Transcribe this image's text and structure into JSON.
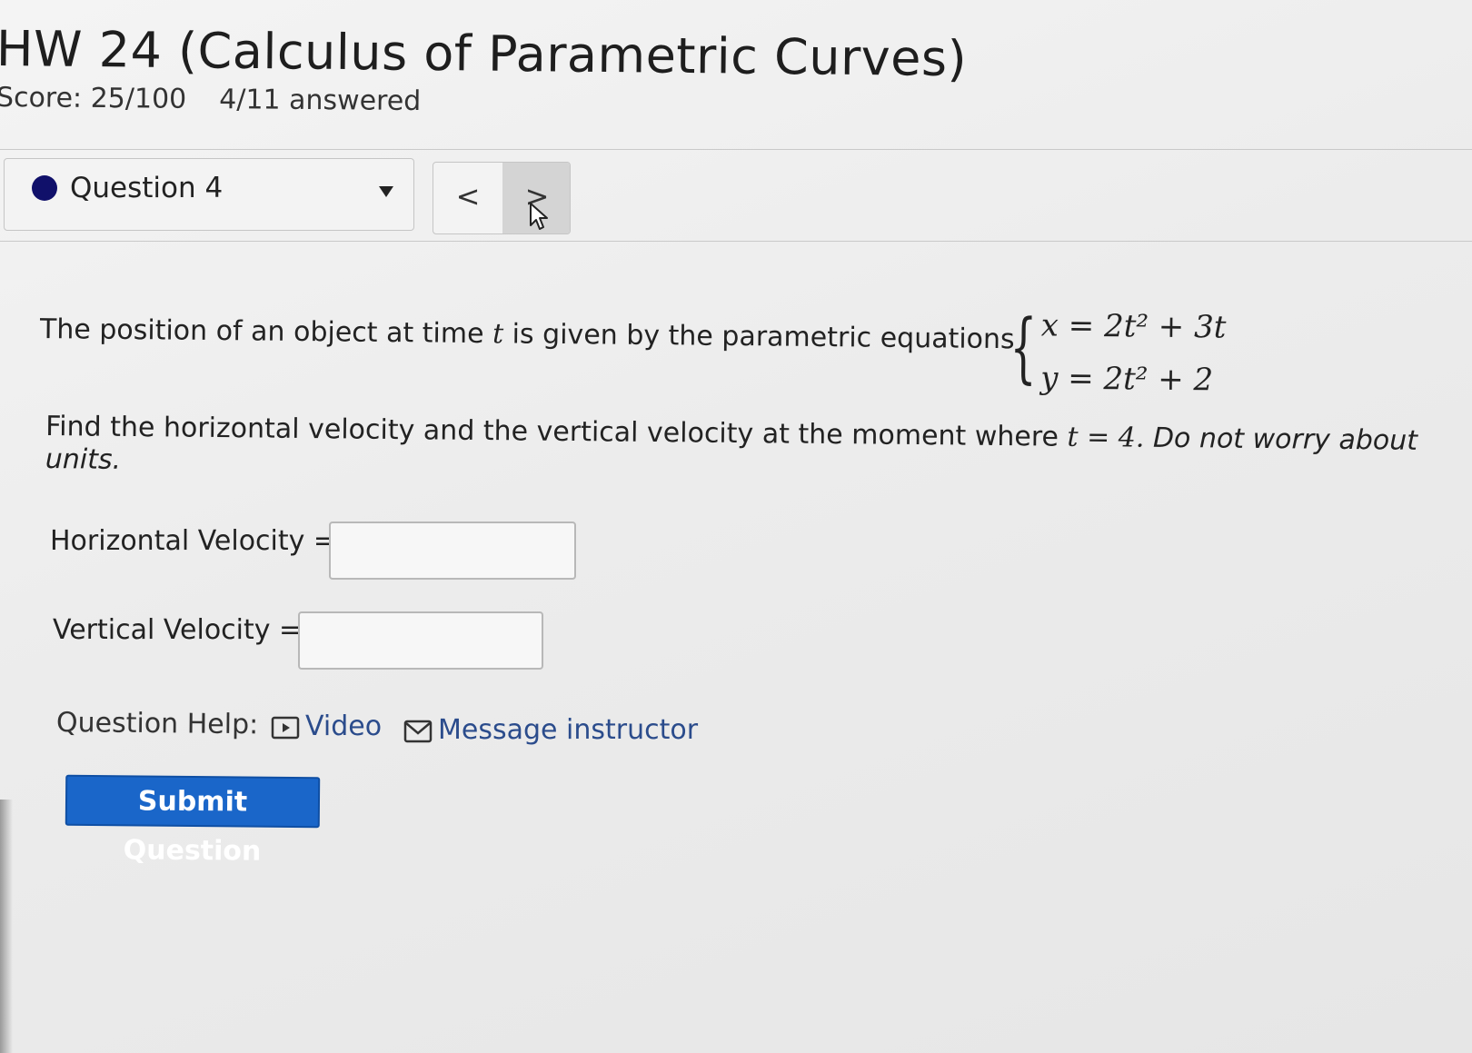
{
  "header": {
    "title": "HW 24 (Calculus of Parametric Curves)",
    "score": "Score: 25/100",
    "answered": "4/11 answered"
  },
  "question_nav": {
    "selected_question": "Question 4",
    "prev_label": "<",
    "next_label": ">"
  },
  "problem": {
    "intro_before_t": "The position of an object at time",
    "variable_t": "t",
    "intro_after_t": "is given by the parametric equations",
    "equation_x": "x = 2t² + 3t",
    "equation_y": "y = 2t² + 2",
    "find_text": "Find the horizontal velocity and the vertical velocity at the moment where",
    "find_math": "t = 4.",
    "find_italic": "Do not worry about units."
  },
  "fields": {
    "horizontal_label": "Horizontal Velocity =",
    "horizontal_value": "",
    "vertical_label": "Vertical Velocity =",
    "vertical_value": ""
  },
  "help": {
    "label": "Question Help:",
    "video_label": "Video",
    "message_label": "Message instructor"
  },
  "actions": {
    "submit_label": "Submit Question"
  },
  "colors": {
    "status_dot": "#10106a",
    "submit_bg": "#1a66c9",
    "link": "#2b4c8c"
  }
}
